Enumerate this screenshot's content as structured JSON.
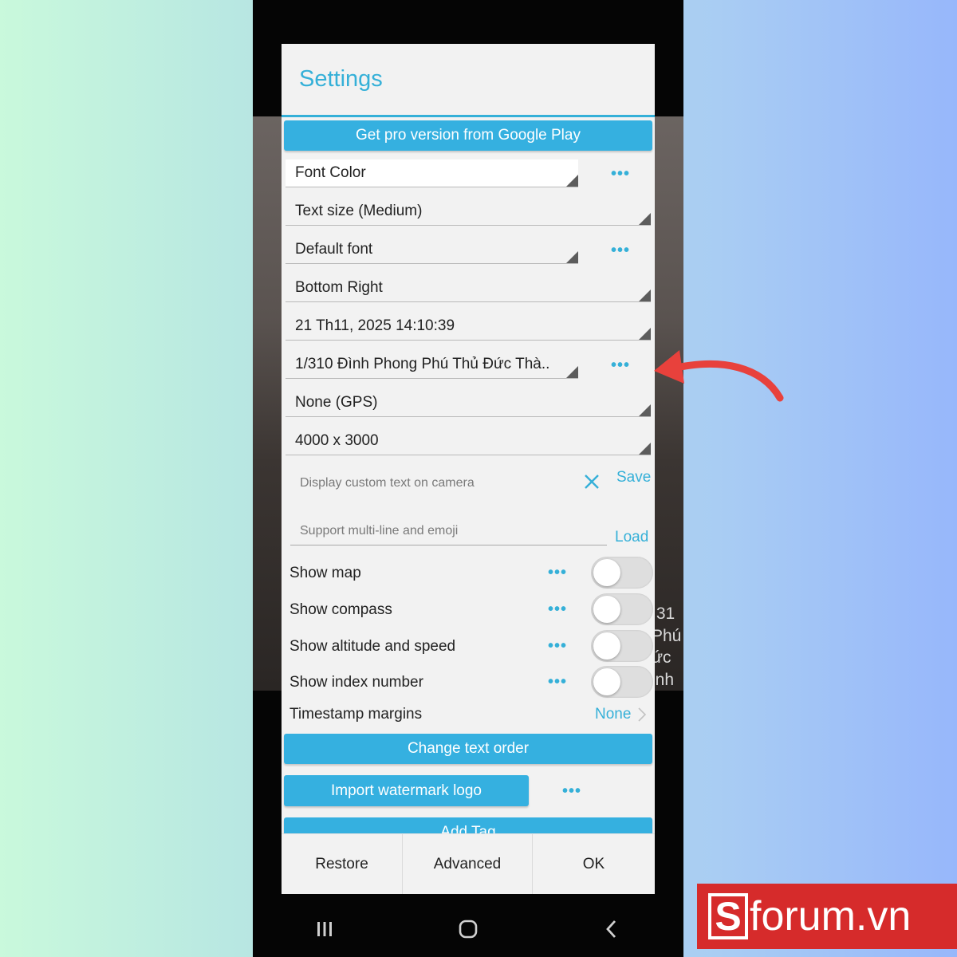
{
  "dialog": {
    "title": "Settings",
    "pro_button": "Get pro version from Google Play",
    "spinners": [
      {
        "value": "Font Color",
        "has_more": true
      },
      {
        "value": "Text size (Medium)",
        "has_more": false
      },
      {
        "value": "Default font",
        "has_more": true
      },
      {
        "value": "Bottom Right",
        "has_more": false
      },
      {
        "value": "21 Th11, 2025 14:10:39",
        "has_more": false
      },
      {
        "value": "1/310 Đình Phong Phú Thủ Đức Thà..",
        "has_more": true
      },
      {
        "value": "None (GPS)",
        "has_more": false
      },
      {
        "value": "4000 x 3000",
        "has_more": false
      }
    ],
    "custom_text": {
      "placeholder": "Display custom text on camera",
      "save": "Save",
      "multiline_placeholder": "Support multi-line and emoji",
      "load": "Load"
    },
    "toggles": [
      {
        "label": "Show map",
        "on": false
      },
      {
        "label": "Show compass",
        "on": false
      },
      {
        "label": "Show altitude and speed",
        "on": false
      },
      {
        "label": "Show index number",
        "on": false
      }
    ],
    "timestamp_margins": {
      "label": "Timestamp margins",
      "value": "None"
    },
    "change_order": "Change text order",
    "import_logo": "Import watermark logo",
    "add_tag": "Add Tag",
    "bottom_buttons": {
      "restore": "Restore",
      "advanced": "Advanced",
      "ok": "OK"
    }
  },
  "camera_overlay": [
    ":31",
    "Phú",
    "ức",
    "inh"
  ],
  "brand": {
    "s": "S",
    "text": "forum.vn"
  },
  "colors": {
    "accent": "#35b0e0",
    "arrow": "#e8413c",
    "brand_bg": "#d62b2b"
  }
}
